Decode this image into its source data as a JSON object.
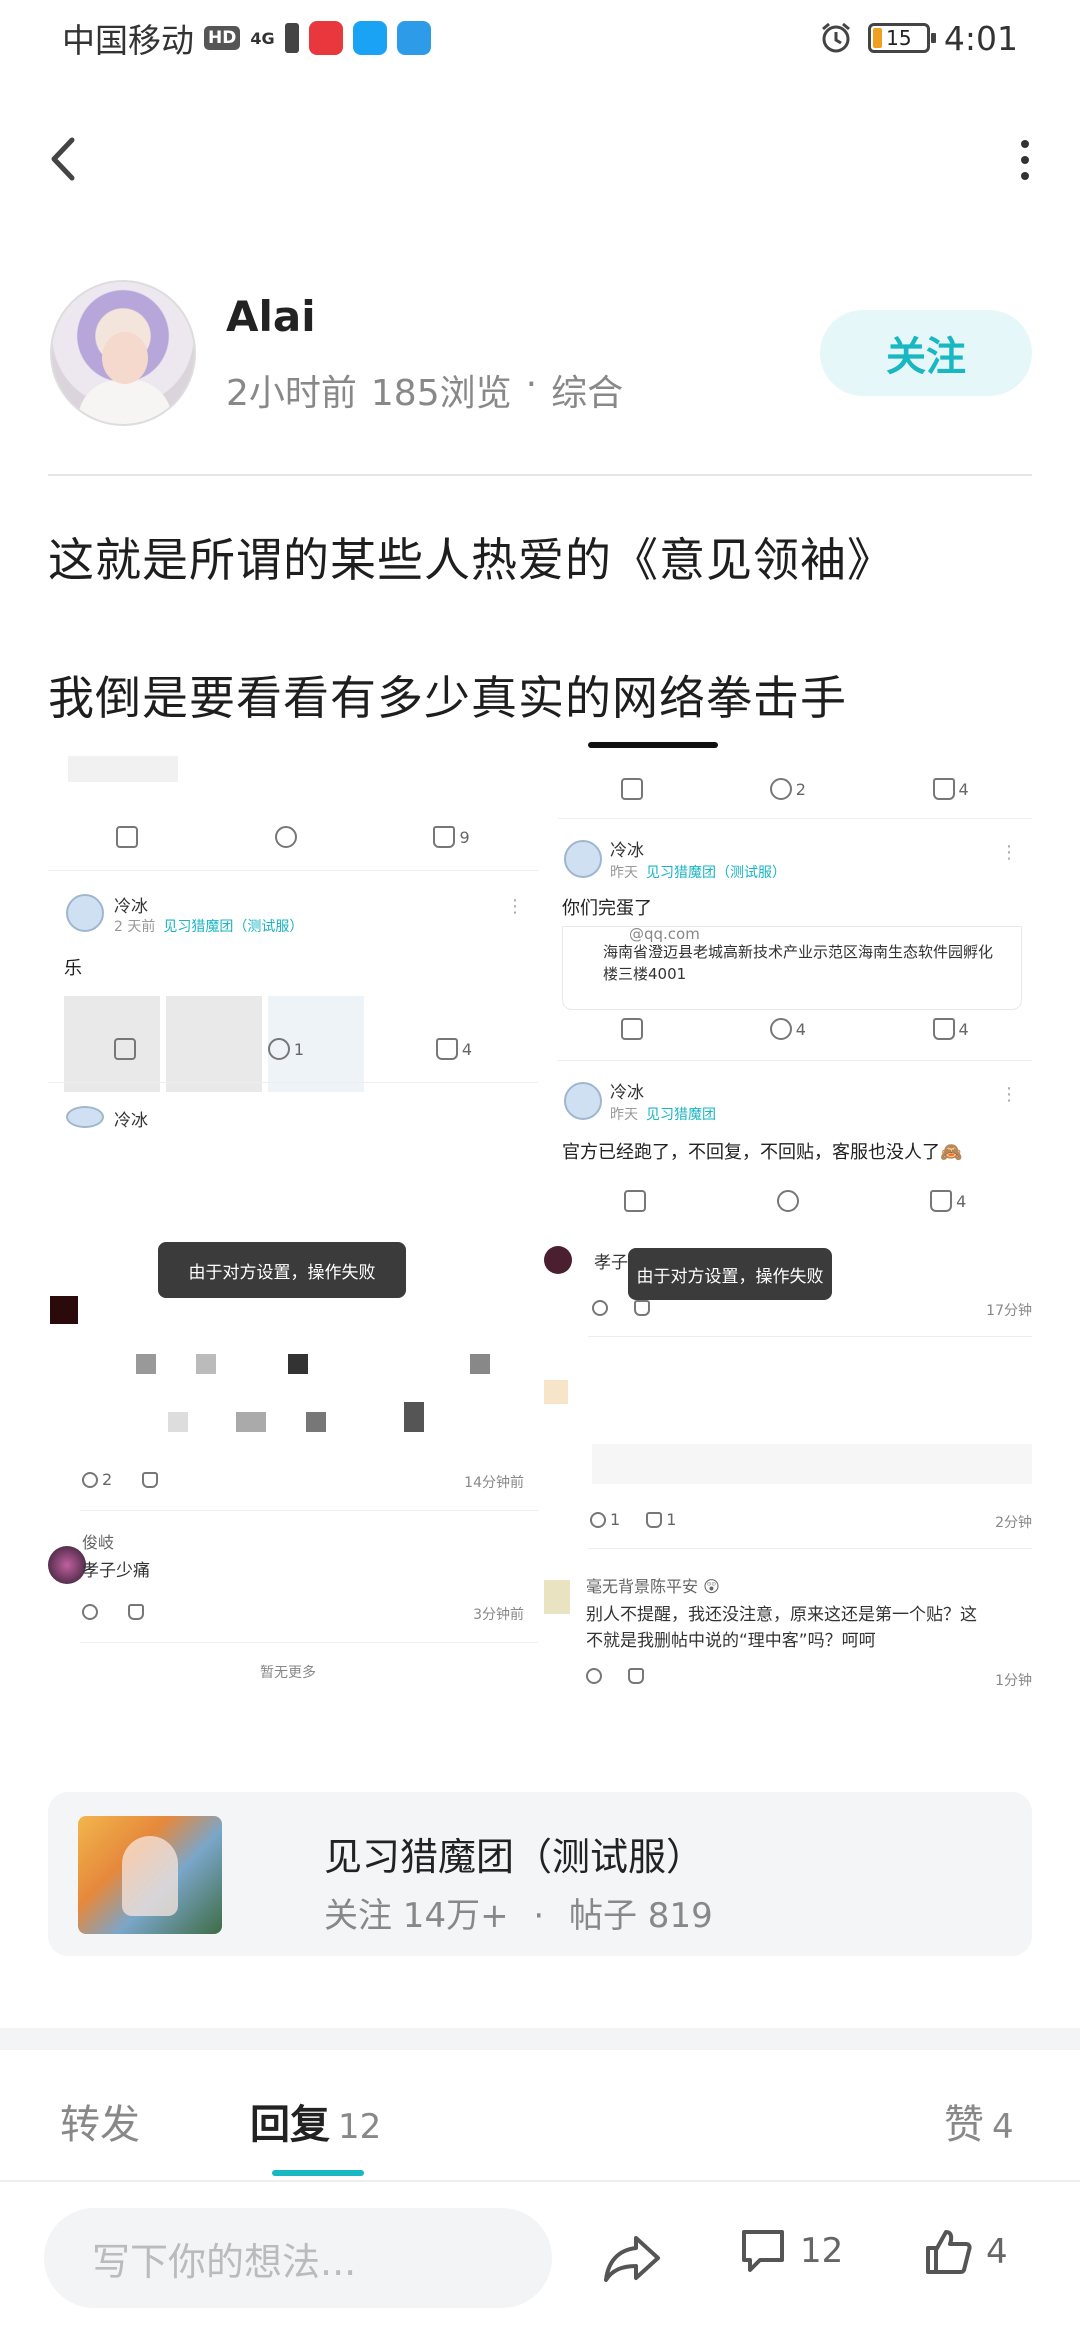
{
  "status_bar": {
    "carrier": "中国移动",
    "hd": "HD",
    "signal": "4G",
    "battery": "15",
    "time": "4:01"
  },
  "author": {
    "name": "Alai",
    "time": "2小时前",
    "views": "185浏览",
    "category": "综合",
    "follow_label": "关注"
  },
  "post": {
    "line1": "这就是所谓的某些人热爱的《意见领袖》",
    "line2": "我倒是要看看有多少真实的网络拳击手"
  },
  "screenshot": {
    "left": {
      "top_like": "9",
      "post1_name": "冷冰",
      "post1_time": "2 天前",
      "post1_tag": "见习猎魔团（测试服）",
      "post1_body": "乐",
      "post1_comments": "1",
      "post1_likes": "4",
      "post2_name": "冷冰",
      "toast": "由于对方设置，操作失败",
      "c1_comments": "2",
      "c1_time": "14分钟前",
      "c2_name": "俊岐",
      "c2_body": "孝子少痛",
      "c2_time": "3分钟前",
      "no_more": "暂无更多"
    },
    "right": {
      "top_comments": "2",
      "top_likes": "4",
      "post1_name": "冷冰",
      "post1_time": "昨天",
      "post1_tag": "见习猎魔团（测试服）",
      "post1_body": "你们完蛋了",
      "post1_email": "@qq.com",
      "post1_address": "海南省澄迈县老城高新技术产业示范区海南生态软件园孵化楼三楼4001",
      "post1_comments": "4",
      "post1_likes": "4",
      "post2_name": "冷冰",
      "post2_time": "昨天",
      "post2_tag": "见习猎魔团",
      "post2_body": "官方已经跑了，不回复，不回贴，客服也没人了🙈",
      "post2_likes": "4",
      "c1_name": "孝子少痛",
      "toast": "由于对方设置，操作失败",
      "c1_time": "17分钟",
      "c2_comments": "1",
      "c2_likes": "1",
      "c2_time": "2分钟",
      "c3_name": "毫无背景陈平安 😲",
      "c3_body1": "别人不提醒，我还没注意，原来这还是第一个贴？这",
      "c3_body2": "不就是我删帖中说的“理中客”吗？呵呵",
      "c3_time": "1分钟"
    }
  },
  "community": {
    "name": "见习猎魔团（测试服）",
    "followers": "关注 14万+",
    "posts": "帖子 819"
  },
  "tabs": {
    "forward": "转发",
    "reply": "回复",
    "reply_count": "12",
    "like": "赞",
    "like_count": "4"
  },
  "bottom_bar": {
    "placeholder": "写下你的想法...",
    "comment_count": "12",
    "like_count": "4"
  }
}
